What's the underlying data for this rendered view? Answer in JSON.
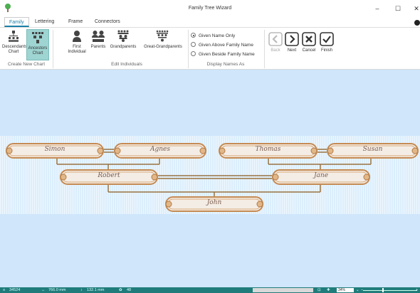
{
  "window": {
    "title": "Family Tree Wizard",
    "minimize_label": "–",
    "maximize_label": "☐",
    "close_label": "✕"
  },
  "tabs": [
    {
      "label": "Family",
      "active": true
    },
    {
      "label": "Lettering",
      "active": false
    },
    {
      "label": "Frame",
      "active": false
    },
    {
      "label": "Connectors",
      "active": false
    }
  ],
  "ribbon": {
    "create_new_chart": {
      "group_label": "Create New Chart",
      "descendants": {
        "line1": "Descendants",
        "line2": "Chart"
      },
      "ancestors": {
        "line1": "Ancestors",
        "line2": "Chart"
      }
    },
    "edit_individuals": {
      "group_label": "Edit Individuals",
      "first_individual": {
        "line1": "First",
        "line2": "Individual"
      },
      "parents": "Parents",
      "grandparents": "Grandparents",
      "great_grandparents": "Great-Grandparents"
    },
    "display_names": {
      "group_label": "Display Names As",
      "options": [
        {
          "label": "Given Name Only",
          "selected": true
        },
        {
          "label": "Given Above Family Name",
          "selected": false
        },
        {
          "label": "Given Beside Family Name",
          "selected": false
        }
      ]
    },
    "nav": {
      "back": "Back",
      "next": "Next",
      "cancel": "Cancel",
      "finish": "Finish"
    }
  },
  "tree": {
    "great_grandparents": [
      "Simon",
      "Agnes",
      "Thomas",
      "Susan"
    ],
    "grandparents": [
      "Robert",
      "Jane"
    ],
    "individual": "John",
    "frame_color": "#c58a52",
    "connector_color": "#9a7240",
    "name_color": "#7a5a4a"
  },
  "status": {
    "stitches": "34524",
    "width": "766.0 mm",
    "height": "132.1 mm",
    "colors": "48",
    "zoom": "34%"
  },
  "colors": {
    "accent": "#1a7fa6",
    "statusbar": "#1f7c7a",
    "canvas": "#cfe6fb"
  }
}
